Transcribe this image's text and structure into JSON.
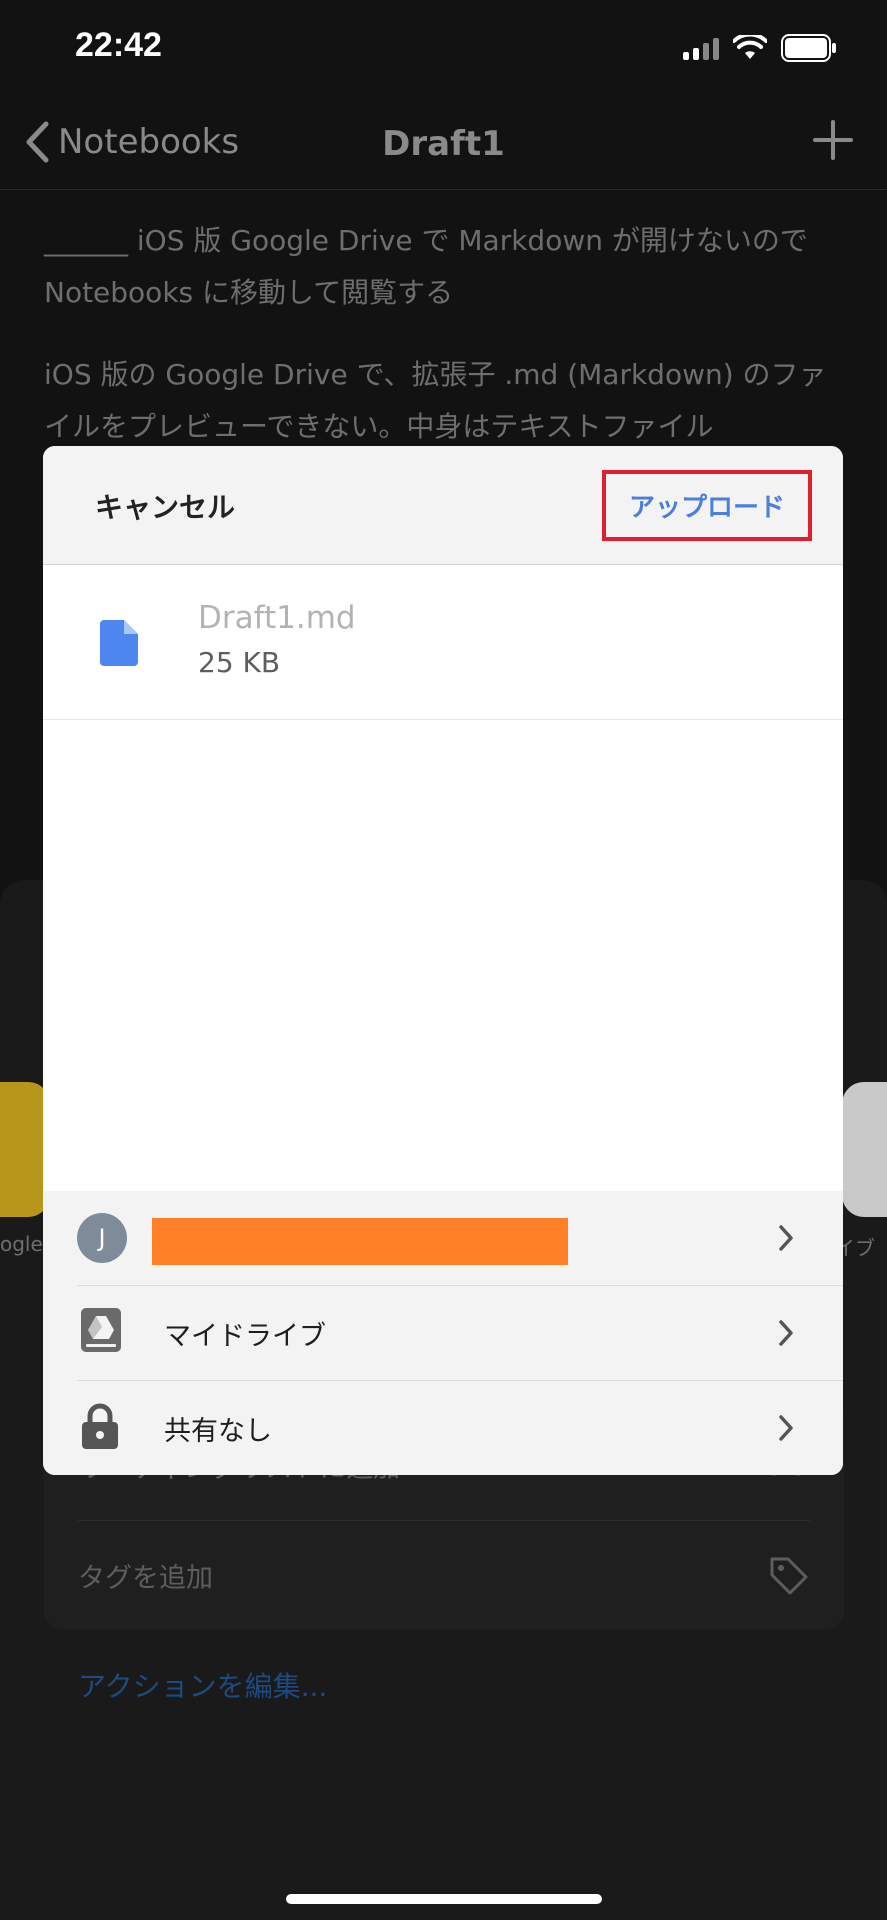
{
  "status_bar": {
    "time": "22:42"
  },
  "nav": {
    "back_label": "Notebooks",
    "title": "Draft1"
  },
  "note": {
    "paragraph1": "______ iOS 版 Google Drive で Markdown が開けないので Notebooks に移動して閲覧する",
    "paragraph2": "iOS 版の Google Drive で、拡張子 .md (Markdown) のファイルをプレビューできない。中身はテキストファイル"
  },
  "share_sheet": {
    "app_left_label": "ogle",
    "app_right_label": "イブ",
    "actions": [
      {
        "label": "リーディングリストに追加"
      },
      {
        "label": "タグを追加"
      }
    ],
    "edit_actions": "アクションを編集..."
  },
  "dialog": {
    "cancel_label": "キャンセル",
    "upload_label": "アップロード",
    "file": {
      "name": "Draft1.md",
      "size": "25 KB"
    },
    "account": {
      "initial": "J"
    },
    "locations": [
      {
        "label": "マイドライブ"
      },
      {
        "label": "共有なし"
      }
    ]
  },
  "colors": {
    "upload_highlight": "#e01f2c",
    "upload_text": "#4a7fdf",
    "redaction": "#ff8027",
    "file_icon": "#4d86f0",
    "avatar": "#7e8b98"
  }
}
